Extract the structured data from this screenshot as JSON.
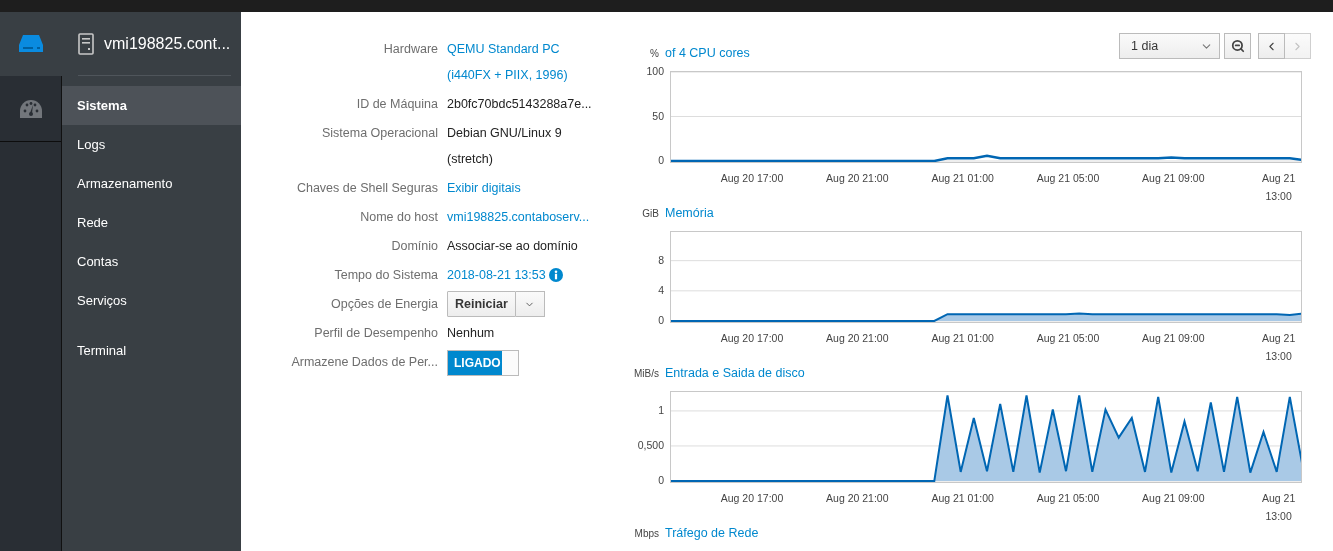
{
  "rail": {
    "items": [
      {
        "kind": "host",
        "selected": true
      },
      {
        "kind": "dashboard",
        "selected": false
      }
    ]
  },
  "nav": {
    "host": "vmi198825.cont...",
    "groups": [
      [
        {
          "label": "Sistema",
          "selected": true
        },
        {
          "label": "Logs",
          "selected": false
        },
        {
          "label": "Armazenamento",
          "selected": false
        },
        {
          "label": "Rede",
          "selected": false
        },
        {
          "label": "Contas",
          "selected": false
        },
        {
          "label": "Serviços",
          "selected": false
        }
      ],
      [
        {
          "label": "Terminal",
          "selected": false
        }
      ]
    ]
  },
  "info": [
    {
      "label": "Hardware",
      "kind": "link",
      "lines": [
        "QEMU Standard PC",
        "(i440FX + PIIX, 1996)"
      ]
    },
    {
      "label": "ID de Máquina",
      "kind": "text",
      "lines": [
        "2b0fc70bdc5143288a7e..."
      ]
    },
    {
      "label": "Sistema Operacional",
      "kind": "text",
      "lines": [
        "Debian GNU/Linux 9",
        "(stretch)"
      ]
    },
    {
      "label": "Chaves de Shell Seguras",
      "kind": "link",
      "lines": [
        "Exibir digitais"
      ]
    },
    {
      "label": "Nome do host",
      "kind": "link",
      "lines": [
        "vmi198825.contaboserv..."
      ]
    },
    {
      "label": "Domínio",
      "kind": "text",
      "lines": [
        "Associar-se ao domínio"
      ]
    },
    {
      "label": "Tempo do Sistema",
      "kind": "time",
      "lines": [
        "2018-08-21 13:53"
      ]
    },
    {
      "label": "Opções de Energia",
      "kind": "split-button",
      "lines": [
        "Reiniciar"
      ]
    },
    {
      "label": "Perfil de Desempenho",
      "kind": "text",
      "lines": [
        "Nenhum"
      ]
    },
    {
      "label": "Armazene Dados de Per...",
      "kind": "toggle",
      "lines": [
        "LIGADO"
      ],
      "on": true
    }
  ],
  "toolbar": {
    "range": "1 dia",
    "next_disabled": true
  },
  "charts": [
    {
      "unit": "%",
      "title": "of 4 CPU cores",
      "chart_data": {
        "type": "line",
        "categories": [
          null,
          null,
          null,
          null,
          null,
          null,
          "Aug 20 17:00",
          null,
          null,
          null,
          null,
          null,
          null,
          null,
          "Aug 20 21:00",
          null,
          null,
          null,
          null,
          null,
          null,
          null,
          "Aug 21 01:00",
          null,
          null,
          null,
          null,
          null,
          null,
          null,
          "Aug 21 05:00",
          null,
          null,
          null,
          null,
          null,
          null,
          null,
          "Aug 21 09:00",
          null,
          null,
          null,
          null,
          null,
          null,
          null,
          "Aug 21 13:00",
          null,
          null
        ],
        "series": [
          {
            "color": "#0066b3",
            "values": [
              0,
              0,
              0,
              0,
              0,
              0,
              0,
              0,
              0,
              0,
              0,
              0,
              0,
              0,
              0,
              0,
              0,
              0,
              0,
              0,
              0,
              3,
              3,
              3,
              6,
              3,
              3,
              3,
              3,
              3,
              3,
              3,
              3,
              3,
              3,
              3,
              3,
              3,
              4,
              3,
              3,
              3,
              3,
              3,
              3,
              3,
              3,
              3,
              1
            ]
          }
        ],
        "ylim": [
          0,
          100
        ],
        "yticks": [
          0,
          50,
          100
        ]
      }
    },
    {
      "unit": "GiB",
      "title": "Memória",
      "chart_data": {
        "type": "area",
        "categories": [
          null,
          null,
          null,
          null,
          null,
          null,
          "Aug 20 17:00",
          null,
          null,
          null,
          null,
          null,
          null,
          null,
          "Aug 20 21:00",
          null,
          null,
          null,
          null,
          null,
          null,
          null,
          "Aug 21 01:00",
          null,
          null,
          null,
          null,
          null,
          null,
          null,
          "Aug 21 05:00",
          null,
          null,
          null,
          null,
          null,
          null,
          null,
          "Aug 21 09:00",
          null,
          null,
          null,
          null,
          null,
          null,
          null,
          "Aug 21 13:00",
          null,
          null
        ],
        "series": [
          {
            "color": "#0066b3",
            "values": [
              0,
              0,
              0,
              0,
              0,
              0,
              0,
              0,
              0,
              0,
              0,
              0,
              0,
              0,
              0,
              0,
              0,
              0,
              0,
              0,
              0,
              0.9,
              0.9,
              0.9,
              0.9,
              0.9,
              0.9,
              0.9,
              0.9,
              0.9,
              0.9,
              1,
              0.9,
              0.9,
              0.9,
              0.9,
              0.9,
              0.9,
              0.9,
              0.9,
              0.9,
              0.9,
              0.9,
              0.9,
              0.9,
              0.9,
              0.9,
              0.8,
              1
            ]
          }
        ],
        "ylim": [
          0,
          11.8
        ],
        "yticks": [
          0,
          4,
          8
        ]
      }
    },
    {
      "unit": "MiB/s",
      "title": "Entrada e Saida de disco",
      "chart_data": {
        "type": "area",
        "categories": [
          null,
          null,
          null,
          null,
          null,
          null,
          "Aug 20 17:00",
          null,
          null,
          null,
          null,
          null,
          null,
          null,
          "Aug 20 21:00",
          null,
          null,
          null,
          null,
          null,
          null,
          null,
          "Aug 21 01:00",
          null,
          null,
          null,
          null,
          null,
          null,
          null,
          "Aug 21 05:00",
          null,
          null,
          null,
          null,
          null,
          null,
          null,
          "Aug 21 09:00",
          null,
          null,
          null,
          null,
          null,
          null,
          null,
          "Aug 21 13:00",
          null,
          null
        ],
        "series": [
          {
            "color": "#0066b3",
            "values": [
              0,
              0,
              0,
              0,
              0,
              0,
              0,
              0,
              0,
              0,
              0,
              0,
              0,
              0,
              0,
              0,
              0,
              0,
              0,
              0,
              0,
              1.22,
              0.13,
              0.9,
              0.14,
              1.1,
              0.13,
              1.22,
              0.12,
              1.02,
              0.14,
              1.22,
              0.13,
              1.02,
              0.62,
              0.9,
              0.13,
              1.2,
              0.12,
              0.85,
              0.14,
              1.12,
              0.13,
              1.2,
              0.12,
              0.7,
              0.13,
              1.2,
              0.18
            ]
          }
        ],
        "ylim": [
          0,
          1.27
        ],
        "yticks": [
          0,
          {
            "value": 0.5,
            "label": "0,500"
          },
          1
        ]
      }
    },
    {
      "unit": "Mbps",
      "title": "Tráfego de Rede"
    }
  ]
}
